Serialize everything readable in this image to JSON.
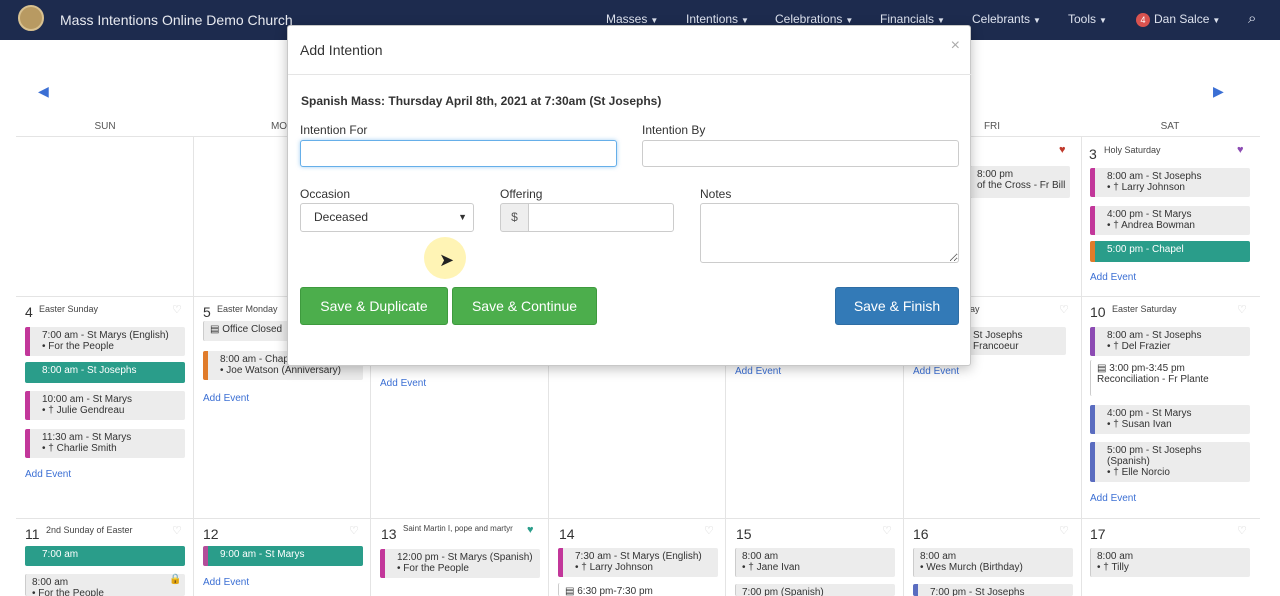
{
  "navbar": {
    "brand": "Mass Intentions Online Demo Church",
    "menu": [
      "Masses",
      "Intentions",
      "Celebrations",
      "Financials",
      "Celebrants",
      "Tools"
    ],
    "user_badge": "4",
    "user_name": "Dan Salce"
  },
  "calendar": {
    "days_of_week": [
      "SUN",
      "MO",
      "FRI",
      "SAT"
    ],
    "sat_3": {
      "num": "3",
      "title": "Holy Saturday"
    },
    "events": {
      "fri_a": "8:00 pm",
      "fri_b": "of the Cross - Fr Bill",
      "sat3_1": "8:00 am - St Josephs\n• † Larry Johnson",
      "sat3_2": "4:00 pm - St Marys\n• † Andrea Bowman",
      "sat3_3": "5:00 pm - Chapel",
      "sun4_1": "7:00 am - St Marys (English)\n• For the People",
      "sun4_2": "8:00 am - St Josephs",
      "sun4_3": "10:00 am - St Marys\n• † Julie Gendreau",
      "sun4_4": "11:30 am - St Marys\n• † Charlie Smith",
      "mon5_1": "Office Closed",
      "mon5_2": "8:00 am - Chap\n• Joe Watson (Anniversary)",
      "thu_fri_a": "St Josephs",
      "thu_fri_b": "Francoeur",
      "sat10_1": "8:00 am - St Josephs\n• † Del Frazier",
      "sat10_2": "3:00 pm-3:45 pm\nReconciliation - Fr Plante",
      "sat10_3": "4:00 pm - St Marys\n• † Susan Ivan",
      "sat10_4": "5:00 pm - St Josephs\n(Spanish)\n• † Elle Norcio",
      "sun11_1": "7:00 am",
      "sun11_2": "8:00 am",
      "sun11_3": "• For the People",
      "mon12_1": "9:00 am - St Marys",
      "tue13_1": "12:00 pm - St Marys (Spanish)\n• For the People",
      "wed14_1": "7:30 am - St Marys (English)\n• † Larry Johnson",
      "wed14_2": "6:30 pm-7:30 pm",
      "thu15_1": "8:00 am\n• † Jane Ivan",
      "thu15_2": "7:00 pm (Spanish)",
      "fri16_1": "8:00 am\n• Wes Murch (Birthday)",
      "fri16_2": "7:00 pm - St Josephs",
      "sat17_1": "8:00 am\n• † Tilly"
    },
    "days": {
      "sun4": {
        "num": "4",
        "title": "Easter Sunday"
      },
      "mon5": {
        "num": "5",
        "title": "Easter Monday"
      },
      "thu_partial": "ay",
      "sat10": {
        "num": "10",
        "title": "Easter Saturday"
      },
      "sun11": {
        "num": "11",
        "title": "2nd Sunday of Easter"
      },
      "mon12": {
        "num": "12",
        "title": ""
      },
      "tue13": {
        "num": "13",
        "title": "Saint Martin I, pope and martyr"
      },
      "wed14": {
        "num": "14",
        "title": ""
      },
      "thu15": {
        "num": "15",
        "title": ""
      },
      "fri16": {
        "num": "16",
        "title": ""
      },
      "sat17": {
        "num": "17",
        "title": ""
      },
      "fri_partial": "ay"
    },
    "add_event": "Add Event"
  },
  "modal": {
    "title": "Add Intention",
    "close": "×",
    "mass_info": "Spanish Mass: Thursday April 8th, 2021 at 7:30am (St Josephs)",
    "intention_for_label": "Intention For",
    "intention_for_value": "",
    "intention_by_label": "Intention By",
    "intention_by_value": "",
    "occasion_label": "Occasion",
    "occasion_selected": "Deceased",
    "offering_label": "Offering",
    "offering_prefix": "$",
    "offering_value": "",
    "notes_label": "Notes",
    "notes_value": "",
    "btn_save_duplicate": "Save & Duplicate",
    "btn_save_continue": "Save & Continue",
    "btn_save_finish": "Save & Finish"
  }
}
